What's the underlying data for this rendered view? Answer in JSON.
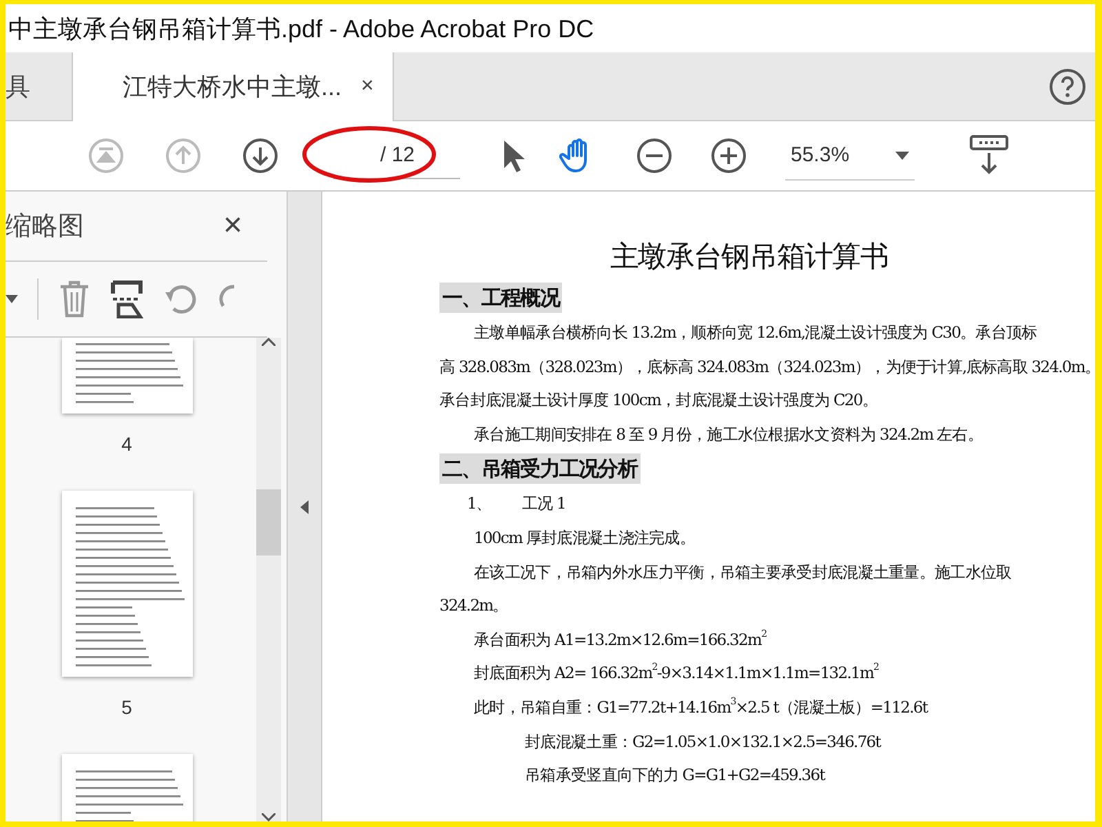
{
  "window": {
    "title": "中主墩承台钢吊箱计算书.pdf - Adobe Acrobat Pro DC"
  },
  "tabs": [
    {
      "label": "具",
      "selected": false
    },
    {
      "label": "江特大桥水中主墩...",
      "selected": true,
      "close": "×"
    }
  ],
  "toolbar": {
    "nav": [
      {
        "kind": "first",
        "disabled": true
      },
      {
        "kind": "prev",
        "disabled": true
      },
      {
        "kind": "next",
        "disabled": false
      }
    ],
    "page": {
      "total": "/ 12"
    },
    "tools": [
      {
        "kind": "select",
        "selected": false
      },
      {
        "kind": "hand",
        "selected": true
      }
    ],
    "zoom": {
      "value": "55.3%"
    }
  },
  "sidebar": {
    "title": "缩略图",
    "close": "×",
    "thumbnails": [
      {
        "label": "4",
        "selected": false
      },
      {
        "label": "5",
        "selected": false
      },
      {
        "selected": false
      }
    ]
  },
  "document": {
    "lines": [
      {
        "kind": "title",
        "text": "主墩承台钢吊箱计算书"
      },
      {
        "kind": "heading",
        "text": "一、工程概况"
      },
      {
        "kind": "para",
        "text": "主墩单幅承台横桥向长 13.2m，顺桥向宽 12.6m,混凝土设计强度为 C30。承台顶标"
      },
      {
        "kind": "cont",
        "text": "高 328.083m（328.023m），底标高 324.083m（324.023m），为便于计算,底标高取 324.0m。"
      },
      {
        "kind": "cont",
        "text": "承台封底混凝土设计厚度 100cm，封底混凝土设计强度为 C20。"
      },
      {
        "kind": "para",
        "text": "承台施工期间安排在 8 至 9 月份，施工水位根据水文资料为 324.2m 左右。"
      },
      {
        "kind": "heading",
        "text": "二、吊箱受力工况分析"
      },
      {
        "kind": "item",
        "text": "1、　　工况 1"
      },
      {
        "kind": "para",
        "text": "100cm 厚封底混凝土浇注完成。"
      },
      {
        "kind": "para",
        "text": "在该工况下，吊箱内外水压力平衡，吊箱主要承受封底混凝土重量。施工水位取"
      },
      {
        "kind": "cont",
        "text": "324.2m。"
      },
      {
        "kind": "para",
        "text": "承台面积为 A1=13.2m×12.6m=166.32m$^{2}$"
      },
      {
        "kind": "para",
        "text": "封底面积为 A2= 166.32m$^{2}$-9×3.14×1.1m×1.1m=132.1m$^{2}$"
      },
      {
        "kind": "para",
        "text": "此时，吊箱自重：G1=77.2t+14.16m$^{3}$×2.5 t（混凝土板）=112.6t"
      },
      {
        "kind": "formula",
        "text": "封底混凝土重：G2=1.05×1.0×132.1×2.5=346.76t"
      },
      {
        "kind": "formula",
        "text": "吊箱承受竖直向下的力 G=G1+G2=459.36t"
      }
    ]
  }
}
